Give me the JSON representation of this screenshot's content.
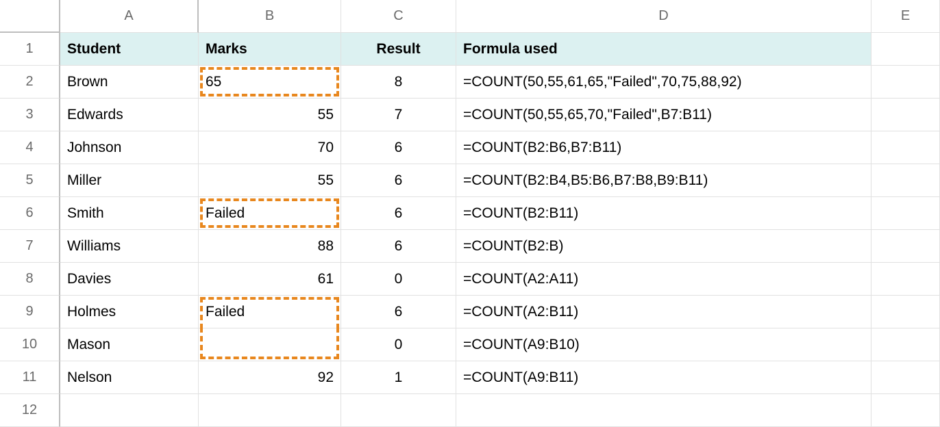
{
  "columns": [
    "A",
    "B",
    "C",
    "D",
    "E"
  ],
  "rows": [
    "1",
    "2",
    "3",
    "4",
    "5",
    "6",
    "7",
    "8",
    "9",
    "10",
    "11",
    "12"
  ],
  "header": {
    "A": "Student",
    "B": "Marks",
    "C": "Result",
    "D": "Formula used"
  },
  "data": [
    {
      "student": "Brown",
      "marks": "65",
      "result": "8",
      "formula": "=COUNT(50,55,61,65,\"Failed\",70,75,88,92)",
      "marks_align": "left",
      "dash": "single"
    },
    {
      "student": "Edwards",
      "marks": "55",
      "result": "7",
      "formula": "=COUNT(50,55,65,70,\"Failed\",B7:B11)",
      "marks_align": "right",
      "dash": ""
    },
    {
      "student": "Johnson",
      "marks": "70",
      "result": "6",
      "formula": "=COUNT(B2:B6,B7:B11)",
      "marks_align": "right",
      "dash": ""
    },
    {
      "student": "Miller",
      "marks": "55",
      "result": "6",
      "formula": "=COUNT(B2:B4,B5:B6,B7:B8,B9:B11)",
      "marks_align": "right",
      "dash": ""
    },
    {
      "student": "Smith",
      "marks": "Failed",
      "result": "6",
      "formula": "=COUNT(B2:B11)",
      "marks_align": "left",
      "dash": "single"
    },
    {
      "student": "Williams",
      "marks": "88",
      "result": "6",
      "formula": "=COUNT(B2:B)",
      "marks_align": "right",
      "dash": ""
    },
    {
      "student": "Davies",
      "marks": "61",
      "result": "0",
      "formula": "=COUNT(A2:A11)",
      "marks_align": "right",
      "dash": ""
    },
    {
      "student": "Holmes",
      "marks": "Failed",
      "result": "6",
      "formula": "=COUNT(A2:B11)",
      "marks_align": "left",
      "dash": "top"
    },
    {
      "student": "Mason",
      "marks": "",
      "result": "0",
      "formula": "=COUNT(A9:B10)",
      "marks_align": "left",
      "dash": "bot"
    },
    {
      "student": "Nelson",
      "marks": "92",
      "result": "1",
      "formula": "=COUNT(A9:B11)",
      "marks_align": "right",
      "dash": ""
    }
  ]
}
